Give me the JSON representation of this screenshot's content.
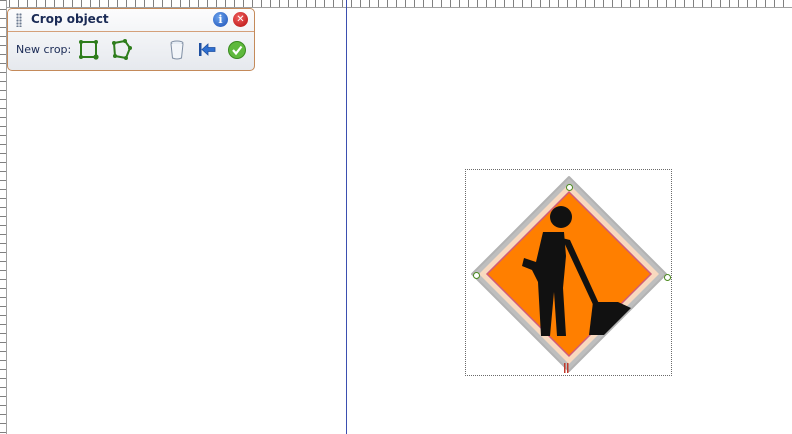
{
  "panel": {
    "title": "Crop object",
    "new_crop_label": "New crop:",
    "icons": {
      "grip": "grip-handle-icon",
      "info": "info-icon",
      "close": "close-icon",
      "rect_crop": "rectangle-crop-icon",
      "poly_crop": "polygon-crop-icon",
      "delete": "delete-icon",
      "reset": "reset-icon",
      "apply": "apply-check-icon"
    },
    "info_glyph": "i",
    "close_glyph": "✕"
  },
  "canvas": {
    "object": "road-work-sign",
    "colors": {
      "sign_fill": "#ff7f00",
      "sign_outer": "#f8d9bf",
      "sign_border": "#bebebe",
      "figure": "#111111",
      "handle_border": "#4b8a1f",
      "page_boundary": "#3b4fb0"
    }
  }
}
